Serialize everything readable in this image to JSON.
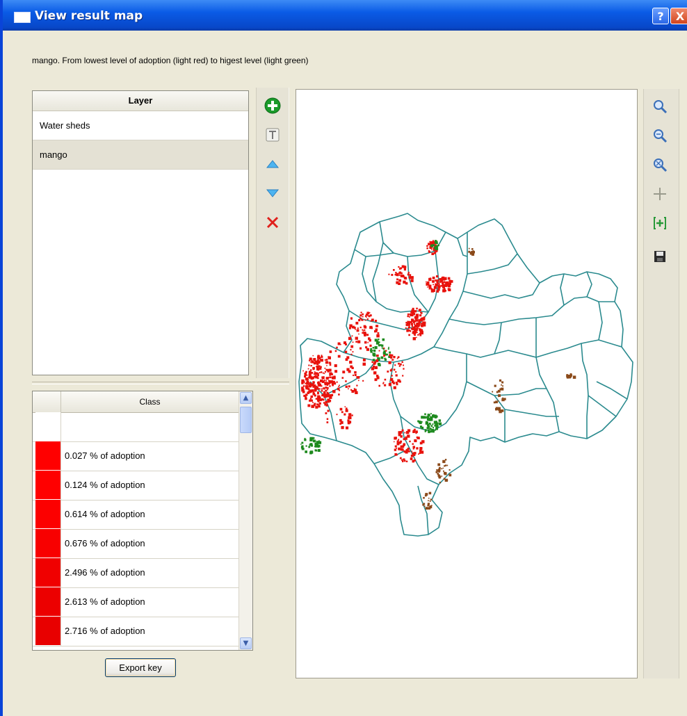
{
  "window": {
    "title": "View result map",
    "help_label": "?",
    "close_label": "X"
  },
  "subtitle": "mango. From lowest level of adoption (light red) to higest level (light green)",
  "layers": {
    "header": "Layer",
    "items": [
      {
        "label": "Water sheds",
        "selected": false
      },
      {
        "label": "mango",
        "selected": true
      }
    ]
  },
  "layer_tools": [
    {
      "icon": "add-layer-icon"
    },
    {
      "icon": "layer-style-icon"
    },
    {
      "icon": "move-up-icon"
    },
    {
      "icon": "move-down-icon"
    },
    {
      "icon": "remove-layer-icon"
    }
  ],
  "classes": {
    "header": "Class",
    "rows": [
      {
        "label": "",
        "color": "#ffffff"
      },
      {
        "label": "0.027 % of adoption",
        "color": "#ff0000"
      },
      {
        "label": "0.124 % of adoption",
        "color": "#ff0000"
      },
      {
        "label": "0.614 % of adoption",
        "color": "#fc0000"
      },
      {
        "label": "0.676 % of adoption",
        "color": "#f80000"
      },
      {
        "label": "2.496 % of adoption",
        "color": "#f00000"
      },
      {
        "label": "2.613 % of adoption",
        "color": "#ec0000"
      },
      {
        "label": "2.716 % of adoption",
        "color": "#e80000"
      }
    ]
  },
  "export_label": "Export key",
  "map_tools": [
    {
      "icon": "zoom-in-icon"
    },
    {
      "icon": "zoom-out-icon"
    },
    {
      "icon": "zoom-full-icon"
    },
    {
      "icon": "pan-icon"
    },
    {
      "icon": "zoom-to-layer-icon"
    },
    {
      "icon": "save-icon"
    }
  ],
  "colors": {
    "boundary": "#2a8a8e",
    "low_adoption": "#e8120c",
    "high_adoption": "#1e8a1e"
  }
}
